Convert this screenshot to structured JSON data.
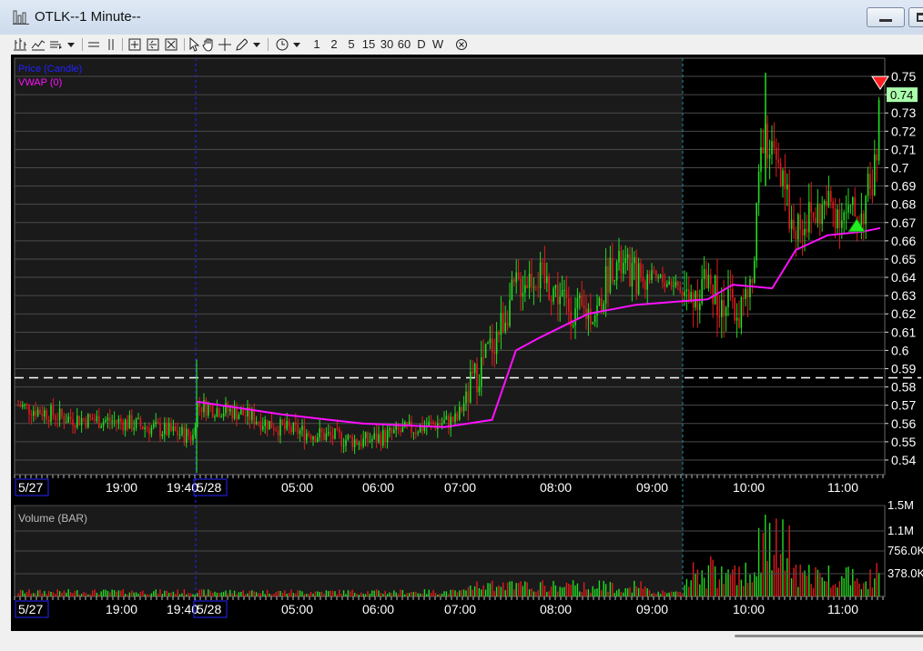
{
  "window": {
    "title": "OTLK--1 Minute--",
    "app_icon": "bar-chart-icon"
  },
  "toolbar": {
    "intervals": [
      "1",
      "2",
      "5",
      "15",
      "30",
      "60",
      "D",
      "W"
    ]
  },
  "chart": {
    "type": "candlestick",
    "symbol": "OTLK",
    "legend": [
      "Price (Candle)",
      "VWAP (0)"
    ],
    "colors": {
      "price_label": "#2222ff",
      "vwap": "#ff10ff",
      "up": "#22dd22",
      "down": "#e01c1c",
      "background_regular": "#000000",
      "background_extended": "#1a1a1a",
      "grid": "#4a4a4a"
    },
    "price_axis": [
      "0.75",
      "0.74",
      "0.73",
      "0.72",
      "0.71",
      "0.7",
      "0.69",
      "0.68",
      "0.67",
      "0.66",
      "0.65",
      "0.64",
      "0.63",
      "0.62",
      "0.61",
      "0.6",
      "0.59",
      "0.58",
      "0.57",
      "0.56",
      "0.55",
      "0.54"
    ],
    "last_price_label": "0.74",
    "dashed_level": 0.585,
    "time_axis": [
      "5/27",
      "19:00",
      "19:40",
      "5/28",
      "05:00",
      "06:00",
      "07:00",
      "08:00",
      "09:00",
      "10:00",
      "11:00"
    ],
    "volume_title": "Volume (BAR)",
    "volume_axis": [
      "1.5M",
      "1.1M",
      "756.0K",
      "378.0K"
    ],
    "vwap_points": [
      [
        "5/28 04:00",
        0.572
      ],
      [
        "05:00",
        0.565
      ],
      [
        "06:00",
        0.56
      ],
      [
        "07:00",
        0.558
      ],
      [
        "07:30",
        0.562
      ],
      [
        "07:45",
        0.6
      ],
      [
        "08:00",
        0.607
      ],
      [
        "08:30",
        0.62
      ],
      [
        "09:00",
        0.625
      ],
      [
        "09:45",
        0.628
      ],
      [
        "10:00",
        0.636
      ],
      [
        "10:25",
        0.634
      ],
      [
        "10:40",
        0.655
      ],
      [
        "11:00",
        0.663
      ],
      [
        "11:30",
        0.665
      ],
      [
        "11:45",
        0.667
      ]
    ],
    "markers": [
      {
        "type": "buy-arrow",
        "price": 0.67,
        "time": "11:25"
      },
      {
        "type": "sell-arrow",
        "price": 0.745,
        "time": "11:45"
      }
    ]
  }
}
